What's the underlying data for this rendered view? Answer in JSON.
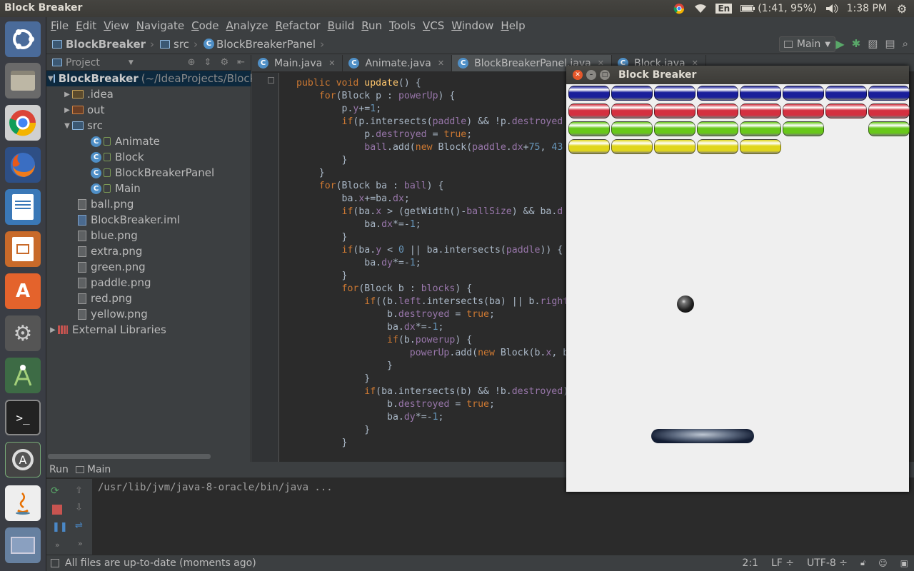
{
  "system": {
    "window_title": "Block Breaker",
    "keyboard_layout": "En",
    "battery": "(1:41, 95%)",
    "clock": "1:38 PM"
  },
  "launcher": [
    "ubuntu-dash-icon",
    "files-icon",
    "chrome-icon",
    "firefox-icon",
    "writer-icon",
    "impress-icon",
    "software-center-icon",
    "settings-icon",
    "android-studio-icon",
    "terminal-icon",
    "updates-icon",
    "java-icon",
    "workspace-icon"
  ],
  "menu": [
    "File",
    "Edit",
    "View",
    "Navigate",
    "Code",
    "Analyze",
    "Refactor",
    "Build",
    "Run",
    "Tools",
    "VCS",
    "Window",
    "Help"
  ],
  "breadcrumb": [
    "BlockBreaker",
    "src",
    "BlockBreakerPanel"
  ],
  "run_config": "Main",
  "project": {
    "title": "Project",
    "root": "BlockBreaker",
    "root_path": "(~/IdeaProjects/Block",
    "nodes": {
      "idea": ".idea",
      "out": "out",
      "src": "src",
      "classes": [
        "Animate",
        "Block",
        "BlockBreakerPanel",
        "Main"
      ],
      "files": [
        "ball.png",
        "BlockBreaker.iml",
        "blue.png",
        "extra.png",
        "green.png",
        "paddle.png",
        "red.png",
        "yellow.png"
      ],
      "libs": "External Libraries"
    }
  },
  "tabs": [
    "Main.java",
    "Animate.java",
    "BlockBreakerPanel.java",
    "Block.java"
  ],
  "code": [
    [
      [
        "kw",
        "public "
      ],
      [
        "kw",
        "void "
      ],
      [
        "fn",
        "update"
      ],
      [
        "t",
        "() {"
      ]
    ],
    [
      [
        "t",
        "    "
      ],
      [
        "kw",
        "for"
      ],
      [
        "t",
        "(Block p : "
      ],
      [
        "fd",
        "powerUp"
      ],
      [
        "t",
        ") {"
      ]
    ],
    [
      [
        "t",
        "        p."
      ],
      [
        "fd",
        "y"
      ],
      [
        "t",
        "+="
      ],
      [
        "nm",
        "1"
      ],
      [
        "t",
        ";"
      ]
    ],
    [
      [
        "t",
        "        "
      ],
      [
        "kw",
        "if"
      ],
      [
        "t",
        "(p.intersects("
      ],
      [
        "fd",
        "paddle"
      ],
      [
        "t",
        ") && !p."
      ],
      [
        "fd",
        "destroyed"
      ]
    ],
    [
      [
        "t",
        "            p."
      ],
      [
        "fd",
        "destroyed"
      ],
      [
        "t",
        " = "
      ],
      [
        "kw",
        "true"
      ],
      [
        "t",
        ";"
      ]
    ],
    [
      [
        "t",
        "            "
      ],
      [
        "fd",
        "ball"
      ],
      [
        "t",
        ".add("
      ],
      [
        "kw",
        "new "
      ],
      [
        "t",
        "Block("
      ],
      [
        "fd",
        "paddle"
      ],
      [
        "t",
        "."
      ],
      [
        "fd",
        "dx"
      ],
      [
        "t",
        "+"
      ],
      [
        "nm",
        "75"
      ],
      [
        "t",
        ", "
      ],
      [
        "nm",
        "43"
      ]
    ],
    [
      [
        "t",
        "        }"
      ]
    ],
    [
      [
        "t",
        "    }"
      ]
    ],
    [
      [
        "t",
        "    "
      ],
      [
        "kw",
        "for"
      ],
      [
        "t",
        "(Block ba : "
      ],
      [
        "fd",
        "ball"
      ],
      [
        "t",
        ") {"
      ]
    ],
    [
      [
        "t",
        "        ba."
      ],
      [
        "fd",
        "x"
      ],
      [
        "t",
        "+=ba."
      ],
      [
        "fd",
        "dx"
      ],
      [
        "t",
        ";"
      ]
    ],
    [
      [
        "t",
        "        "
      ],
      [
        "kw",
        "if"
      ],
      [
        "t",
        "(ba."
      ],
      [
        "fd",
        "x"
      ],
      [
        "t",
        " > (getWidth()-"
      ],
      [
        "fd",
        "ballSize"
      ],
      [
        "t",
        ") && ba."
      ],
      [
        "fd",
        "d"
      ]
    ],
    [
      [
        "t",
        "            ba."
      ],
      [
        "fd",
        "dx"
      ],
      [
        "t",
        "*=-"
      ],
      [
        "nm",
        "1"
      ],
      [
        "t",
        ";"
      ]
    ],
    [
      [
        "t",
        "        }"
      ]
    ],
    [
      [
        "t",
        "        "
      ],
      [
        "kw",
        "if"
      ],
      [
        "t",
        "(ba."
      ],
      [
        "fd",
        "y"
      ],
      [
        "t",
        " < "
      ],
      [
        "nm",
        "0"
      ],
      [
        "t",
        " || ba.intersects("
      ],
      [
        "fd",
        "paddle"
      ],
      [
        "t",
        ")) {"
      ]
    ],
    [
      [
        "t",
        "            ba."
      ],
      [
        "fd",
        "dy"
      ],
      [
        "t",
        "*=-"
      ],
      [
        "nm",
        "1"
      ],
      [
        "t",
        ";"
      ]
    ],
    [
      [
        "t",
        "        }"
      ]
    ],
    [
      [
        "t",
        "        "
      ],
      [
        "kw",
        "for"
      ],
      [
        "t",
        "(Block b : "
      ],
      [
        "fd",
        "blocks"
      ],
      [
        "t",
        ") {"
      ]
    ],
    [
      [
        "t",
        "            "
      ],
      [
        "kw",
        "if"
      ],
      [
        "t",
        "((b."
      ],
      [
        "fd",
        "left"
      ],
      [
        "t",
        ".intersects(ba) || b."
      ],
      [
        "fd",
        "right"
      ]
    ],
    [
      [
        "t",
        "                b."
      ],
      [
        "fd",
        "destroyed"
      ],
      [
        "t",
        " = "
      ],
      [
        "kw",
        "true"
      ],
      [
        "t",
        ";"
      ]
    ],
    [
      [
        "t",
        "                ba."
      ],
      [
        "fd",
        "dx"
      ],
      [
        "t",
        "*=-"
      ],
      [
        "nm",
        "1"
      ],
      [
        "t",
        ";"
      ]
    ],
    [
      [
        "t",
        "                "
      ],
      [
        "kw",
        "if"
      ],
      [
        "t",
        "(b."
      ],
      [
        "fd",
        "powerup"
      ],
      [
        "t",
        ") {"
      ]
    ],
    [
      [
        "t",
        "                    "
      ],
      [
        "fd",
        "powerUp"
      ],
      [
        "t",
        ".add("
      ],
      [
        "kw",
        "new "
      ],
      [
        "t",
        "Block(b."
      ],
      [
        "fd",
        "x"
      ],
      [
        "t",
        ", b"
      ]
    ],
    [
      [
        "t",
        "                }"
      ]
    ],
    [
      [
        "t",
        "            }"
      ]
    ],
    [
      [
        "t",
        "            "
      ],
      [
        "kw",
        "if"
      ],
      [
        "t",
        "(ba.intersects(b) && !b."
      ],
      [
        "fd",
        "destroyed"
      ],
      [
        "t",
        ")"
      ]
    ],
    [
      [
        "t",
        "                b."
      ],
      [
        "fd",
        "destroyed"
      ],
      [
        "t",
        " = "
      ],
      [
        "kw",
        "true"
      ],
      [
        "t",
        ";"
      ]
    ],
    [
      [
        "t",
        "                ba."
      ],
      [
        "fd",
        "dy"
      ],
      [
        "t",
        "*=-"
      ],
      [
        "nm",
        "1"
      ],
      [
        "t",
        ";"
      ]
    ],
    [
      [
        "t",
        "            }"
      ]
    ],
    [
      [
        "t",
        "        }"
      ]
    ]
  ],
  "run": {
    "label": "Run",
    "config": "Main",
    "command": "/usr/lib/jvm/java-8-oracle/bin/java ..."
  },
  "status": {
    "message": "All files are up-to-date (moments ago)",
    "position": "2:1",
    "line_sep": "LF ÷",
    "encoding": "UTF-8 ÷"
  },
  "game": {
    "title": "Block Breaker",
    "colors": {
      "blue": "#1a1f9a",
      "red": "#d43040",
      "green": "#68c81a",
      "yellow": "#e0d61c"
    },
    "rows": [
      {
        "color": "blue",
        "present": [
          1,
          1,
          1,
          1,
          1,
          1,
          1,
          1
        ]
      },
      {
        "color": "red",
        "present": [
          1,
          1,
          1,
          1,
          1,
          1,
          1,
          1
        ]
      },
      {
        "color": "green",
        "present": [
          1,
          1,
          1,
          1,
          1,
          1,
          0,
          1
        ]
      },
      {
        "color": "yellow",
        "present": [
          1,
          1,
          1,
          1,
          1,
          0,
          0,
          0
        ]
      }
    ]
  }
}
